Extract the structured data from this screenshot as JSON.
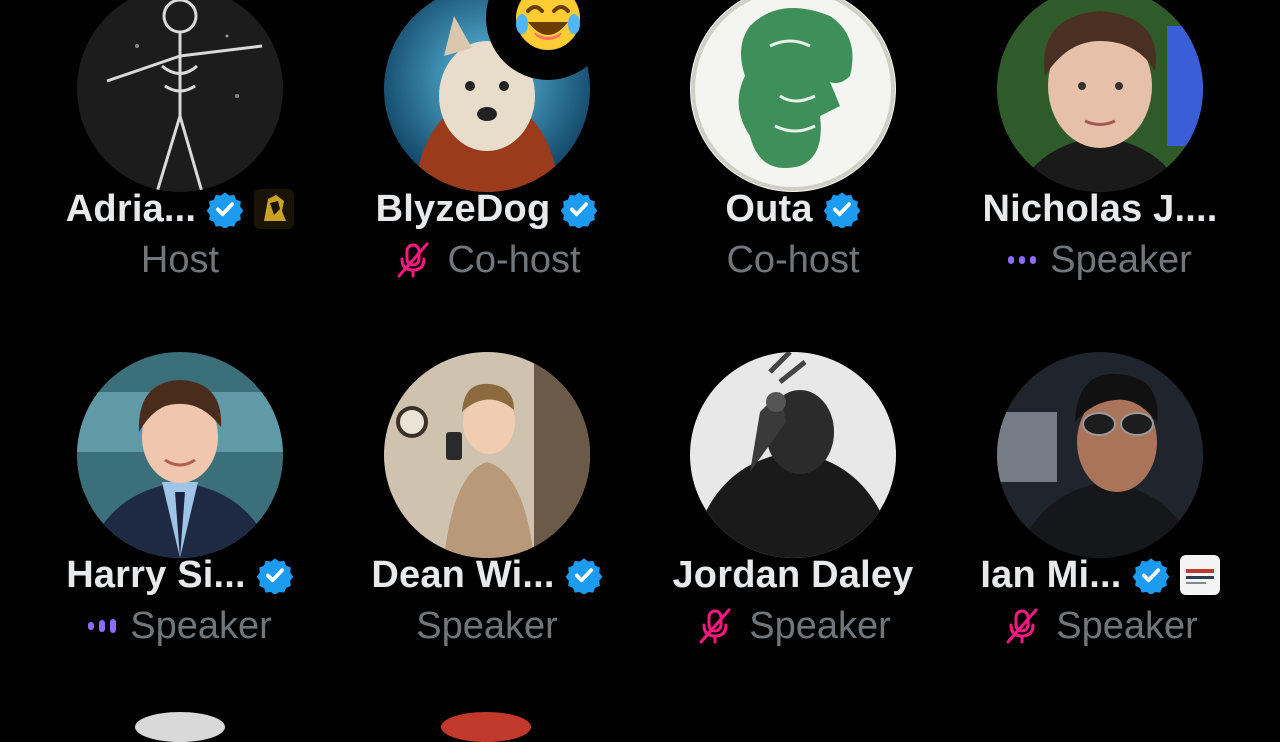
{
  "participants": [
    {
      "name": "Adria...",
      "role": "Host",
      "verified": true,
      "affiliate_badge": "lion-badge-icon",
      "status": "none"
    },
    {
      "name": "BlyzeDog",
      "role": "Co-host",
      "verified": true,
      "status": "muted",
      "reaction": "joy-emoji"
    },
    {
      "name": "Outa",
      "role": "Co-host",
      "verified": true,
      "status": "none"
    },
    {
      "name": "Nicholas J....",
      "role": "Speaker",
      "verified": false,
      "status": "speaking"
    },
    {
      "name": "Harry Si...",
      "role": "Speaker",
      "verified": true,
      "status": "speaking"
    },
    {
      "name": "Dean Wi...",
      "role": "Speaker",
      "verified": true,
      "status": "none"
    },
    {
      "name": "Jordan Daley",
      "role": "Speaker",
      "verified": false,
      "status": "muted"
    },
    {
      "name": "Ian Mi...",
      "role": "Speaker",
      "verified": true,
      "affiliate_badge": "road-to-election-badge-icon",
      "status": "muted"
    }
  ],
  "colors": {
    "background": "#000000",
    "name_text": "#e7e9ea",
    "role_text": "#71767b",
    "verified_blue": "#1d9bf0",
    "muted_pink": "#f91880",
    "speaking_purple": "#8b6cf6"
  }
}
